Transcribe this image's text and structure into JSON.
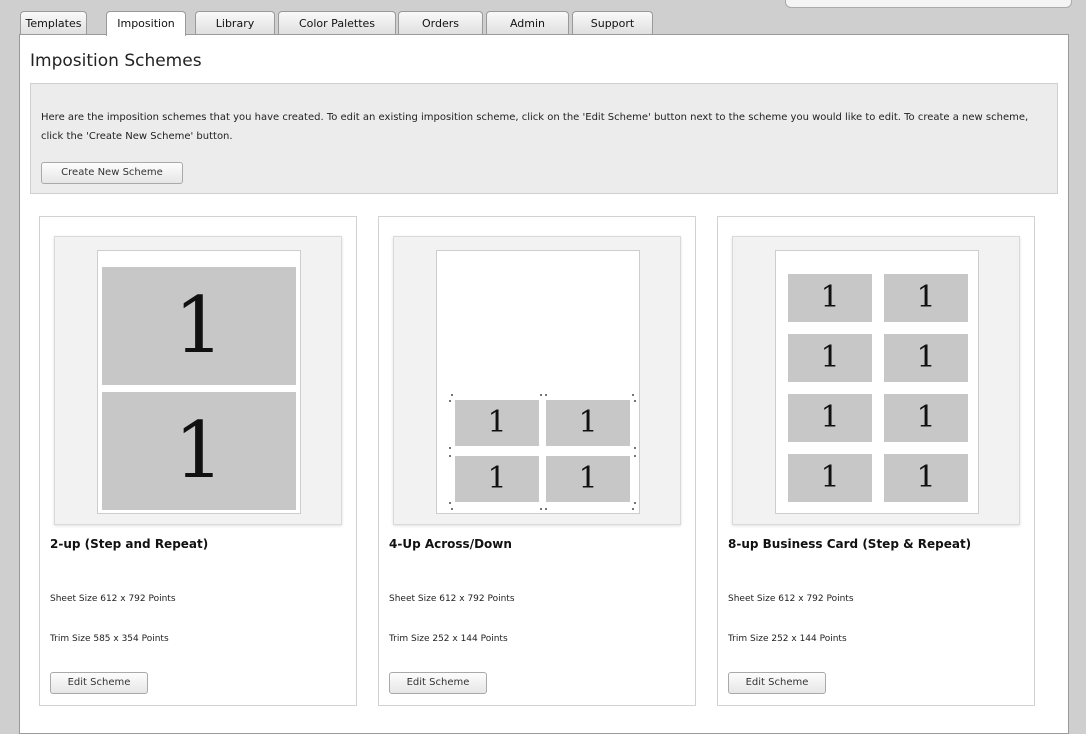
{
  "tabs": [
    "Templates",
    "Imposition",
    "Library",
    "Color Palettes",
    "Orders",
    "Admin",
    "Support"
  ],
  "active_tab": "Imposition",
  "page": {
    "title": "Imposition Schemes",
    "intro": "Here are the imposition schemes that you have created. To edit an existing imposition scheme, click on the 'Edit Scheme' button next to the scheme you would like to edit. To create a new scheme, click the 'Create New Scheme' button.",
    "create_button": "Create New Scheme"
  },
  "cell_label": "1",
  "schemes": [
    {
      "name": "2-up (Step and Repeat)",
      "sheet_size": "Sheet Size 612 x 792 Points",
      "trim_size": "Trim Size 585 x 354 Points",
      "edit_label": "Edit Scheme"
    },
    {
      "name": "4-Up Across/Down",
      "sheet_size": "Sheet Size 612 x 792 Points",
      "trim_size": "Trim Size 252 x 144 Points",
      "edit_label": "Edit Scheme"
    },
    {
      "name": "8-up Business Card (Step & Repeat)",
      "sheet_size": "Sheet Size 612 x 792 Points",
      "trim_size": "Trim Size 252 x 144 Points",
      "edit_label": "Edit Scheme"
    }
  ],
  "colors": {
    "cell_fill": "#c7c7c7",
    "info_bg": "#ececec",
    "page_bg": "#cfcfcf"
  }
}
